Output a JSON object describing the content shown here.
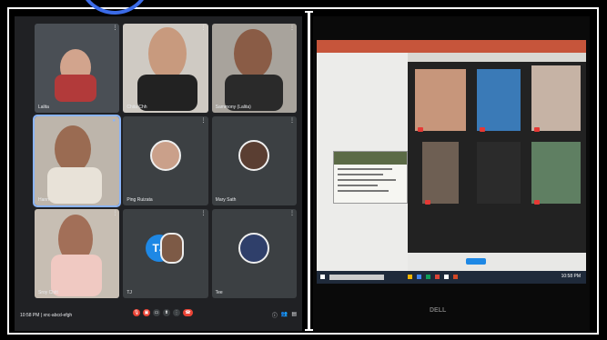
{
  "meet": {
    "participants": [
      {
        "name": "Lalita"
      },
      {
        "name": "Chita Chh"
      },
      {
        "name": "Sammony (Lalita)"
      },
      {
        "name": "Hann"
      },
      {
        "name": "Ping Ruizata"
      },
      {
        "name": "Mary Sath"
      },
      {
        "name": "Sroy Chitt"
      },
      {
        "name": "TJ",
        "initials": "TJ"
      },
      {
        "name": "Tee"
      }
    ],
    "time": "10:58 PM",
    "meeting_code": "xnc-abcd-efgh",
    "accent_color": "#8ab4f8",
    "end_call_color": "#ea4335"
  },
  "laptop": {
    "brand": "DELL",
    "taskbar_time": "10:58 PM"
  }
}
